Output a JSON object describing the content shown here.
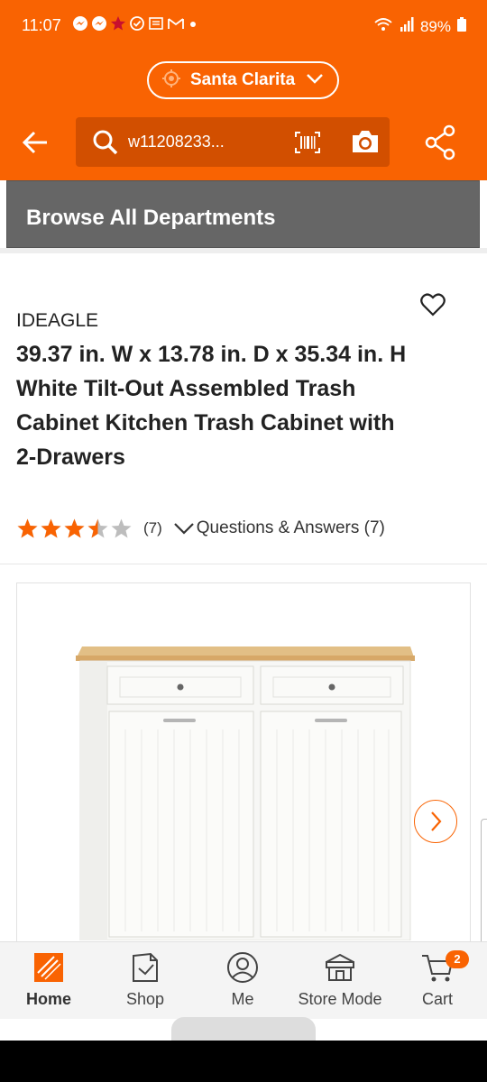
{
  "status_bar": {
    "time": "11:07",
    "battery": "89%",
    "icons": [
      "messenger-icon",
      "messenger-icon",
      "star-icon",
      "check-circle-icon",
      "news-icon",
      "gmail-icon",
      "dot-icon",
      "wifi-icon",
      "signal-icon",
      "battery-icon"
    ]
  },
  "header": {
    "store_name": "Santa Clarita",
    "search_value": "w11208233...",
    "brand_color": "#f96302"
  },
  "department_bar": {
    "label": "Browse All Departments"
  },
  "product": {
    "brand": "IDEAGLE",
    "title": "39.37 in. W x 13.78 in. D x 35.34 in. H White Tilt-Out Assembled Trash Cabinet Kitchen Trash Cabinet with 2-Drawers",
    "rating": 3.5,
    "rating_max": 5,
    "review_count": "(7)",
    "qa_label": "Questions & Answers (7)"
  },
  "bottom_nav": {
    "items": [
      {
        "label": "Home",
        "icon": "home-depot-logo-icon",
        "active": true
      },
      {
        "label": "Shop",
        "icon": "shop-bag-icon",
        "active": false
      },
      {
        "label": "Me",
        "icon": "user-icon",
        "active": false
      },
      {
        "label": "Store Mode",
        "icon": "store-icon",
        "active": false
      },
      {
        "label": "Cart",
        "icon": "cart-icon",
        "active": false
      }
    ],
    "cart_count": "2"
  }
}
